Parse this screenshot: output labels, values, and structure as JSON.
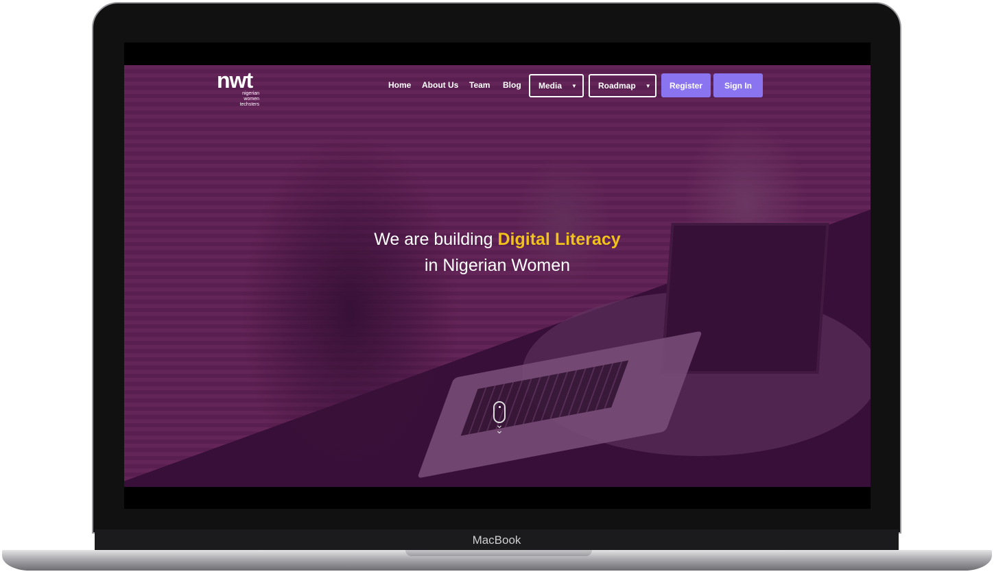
{
  "device": {
    "label": "MacBook"
  },
  "nav": {
    "logo": "nwt",
    "logo_sub": [
      "nigerian",
      "women",
      "techsters"
    ],
    "links": [
      "Home",
      "About Us",
      "Team",
      "Blog"
    ],
    "dropdowns": [
      "Media",
      "Roadmap"
    ],
    "register": "Register",
    "sign_in": "Sign In"
  },
  "hero": {
    "line1_prefix": "We are building ",
    "line1_highlight": "Digital Literacy",
    "line2": "in Nigerian Women"
  },
  "colors": {
    "accent": "#8b74f0",
    "highlight": "#f1c11c",
    "overlay": "#5a1f55"
  }
}
